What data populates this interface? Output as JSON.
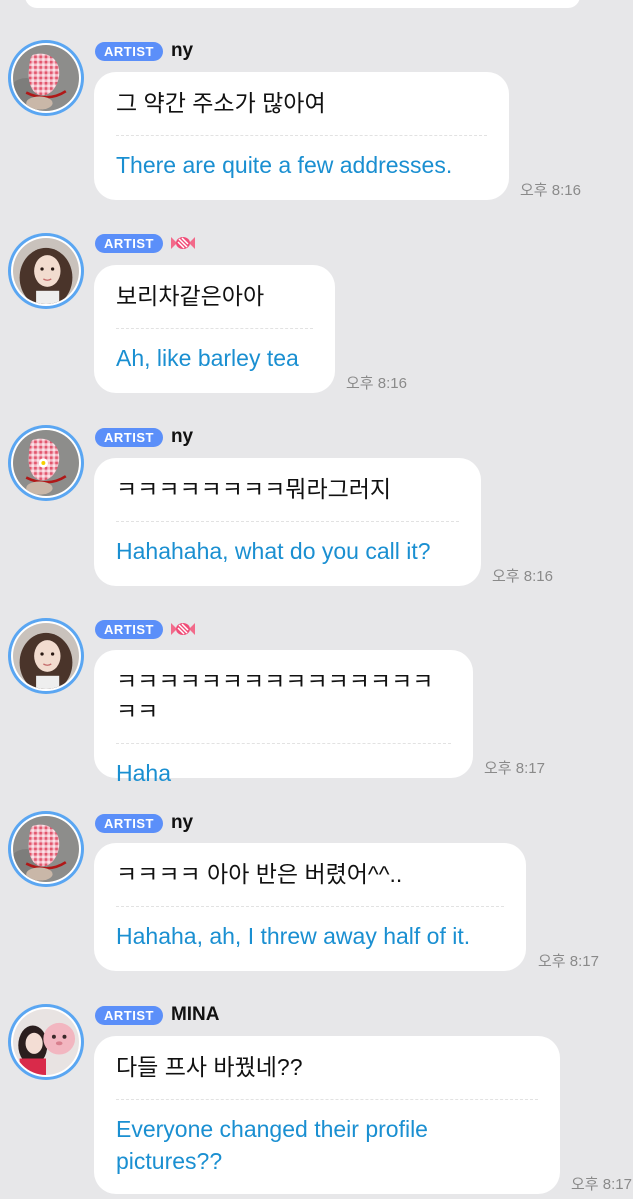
{
  "messages": [
    {
      "badge": "ARTIST",
      "name": "ny",
      "original": "그 약간 주소가 많아여",
      "translation": "There are quite a few addresses.",
      "time": "오후 8:16",
      "avatar": "shoe-avatar"
    },
    {
      "badge": "ARTIST",
      "name": "",
      "icon": "candy-icon",
      "original": "보리차같은아아",
      "translation": "Ah, like barley tea",
      "time": "오후 8:16",
      "avatar": "girl-avatar"
    },
    {
      "badge": "ARTIST",
      "name": "ny",
      "original": "ㅋㅋㅋㅋㅋㅋㅋㅋ뭐라그러지",
      "translation": "Hahahaha, what do you call it?",
      "time": "오후 8:16",
      "avatar": "shoe-avatar"
    },
    {
      "badge": "ARTIST",
      "name": "",
      "icon": "candy-icon",
      "original": "ㅋㅋㅋㅋㅋㅋㅋㅋㅋㅋㅋㅋㅋㅋㅋㅋㅋ",
      "translation": "Haha",
      "time": "오후 8:17",
      "avatar": "girl-avatar"
    },
    {
      "badge": "ARTIST",
      "name": "ny",
      "original": "ㅋㅋㅋㅋ 아아 반은 버렸어^^..",
      "translation": "Hahaha, ah, I threw away half of it.",
      "time": "오후 8:17",
      "avatar": "shoe-avatar"
    },
    {
      "badge": "ARTIST",
      "name": "MINA",
      "original": "다들 프사 바꿨네??",
      "translation_line1": "Everyone changed their profile",
      "translation_line2": "pictures??",
      "time": "오후 8:17",
      "avatar": "mina-avatar"
    }
  ],
  "colors": {
    "background": "#e7e7e9",
    "badge": "#5b8ff9",
    "translation": "#1a8fd1",
    "avatar_ring": "#5aa6f2"
  }
}
